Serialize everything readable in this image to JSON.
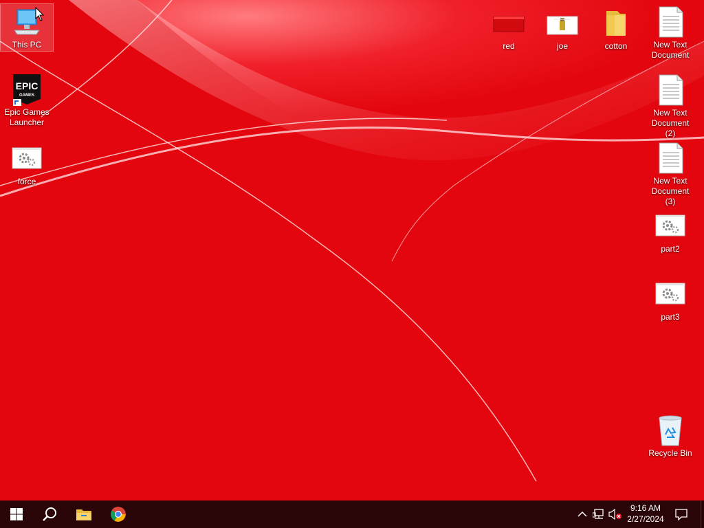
{
  "desktop": {
    "left_icons": [
      {
        "label": "This PC",
        "icon": "computer-icon"
      },
      {
        "label": "Epic Games Launcher",
        "icon": "epic-games-icon"
      },
      {
        "label": "force",
        "icon": "settings-file-icon"
      }
    ],
    "top_icons": [
      {
        "label": "red",
        "icon": "red-file-icon"
      },
      {
        "label": "joe",
        "icon": "archive-file-icon"
      },
      {
        "label": "cotton",
        "icon": "folder-icon"
      }
    ],
    "right_icons": [
      {
        "label": "New Text Document",
        "icon": "text-document-icon"
      },
      {
        "label": "New Text Document (2)",
        "icon": "text-document-icon"
      },
      {
        "label": "New Text Document (3)",
        "icon": "text-document-icon"
      },
      {
        "label": "part2",
        "icon": "settings-file-icon"
      },
      {
        "label": "part3",
        "icon": "settings-file-icon"
      },
      {
        "label": "Recycle Bin",
        "icon": "recycle-bin-icon"
      }
    ],
    "epic_logo_text": {
      "line1": "EPIC",
      "line2": "GAMES"
    }
  },
  "taskbar": {
    "pinned": [
      {
        "name": "start",
        "icon": "windows-icon"
      },
      {
        "name": "search",
        "icon": "search-icon"
      },
      {
        "name": "file-explorer",
        "icon": "folder-icon"
      },
      {
        "name": "chrome",
        "icon": "chrome-icon"
      }
    ],
    "tray": {
      "icons": [
        "chevron-up-icon",
        "network-icon",
        "volume-muted-icon"
      ],
      "time": "9:16 AM",
      "date": "2/27/2024",
      "notification_icon": "notification-icon"
    }
  },
  "colors": {
    "wallpaper": "#e3060e",
    "taskbar": "#2a0507"
  }
}
